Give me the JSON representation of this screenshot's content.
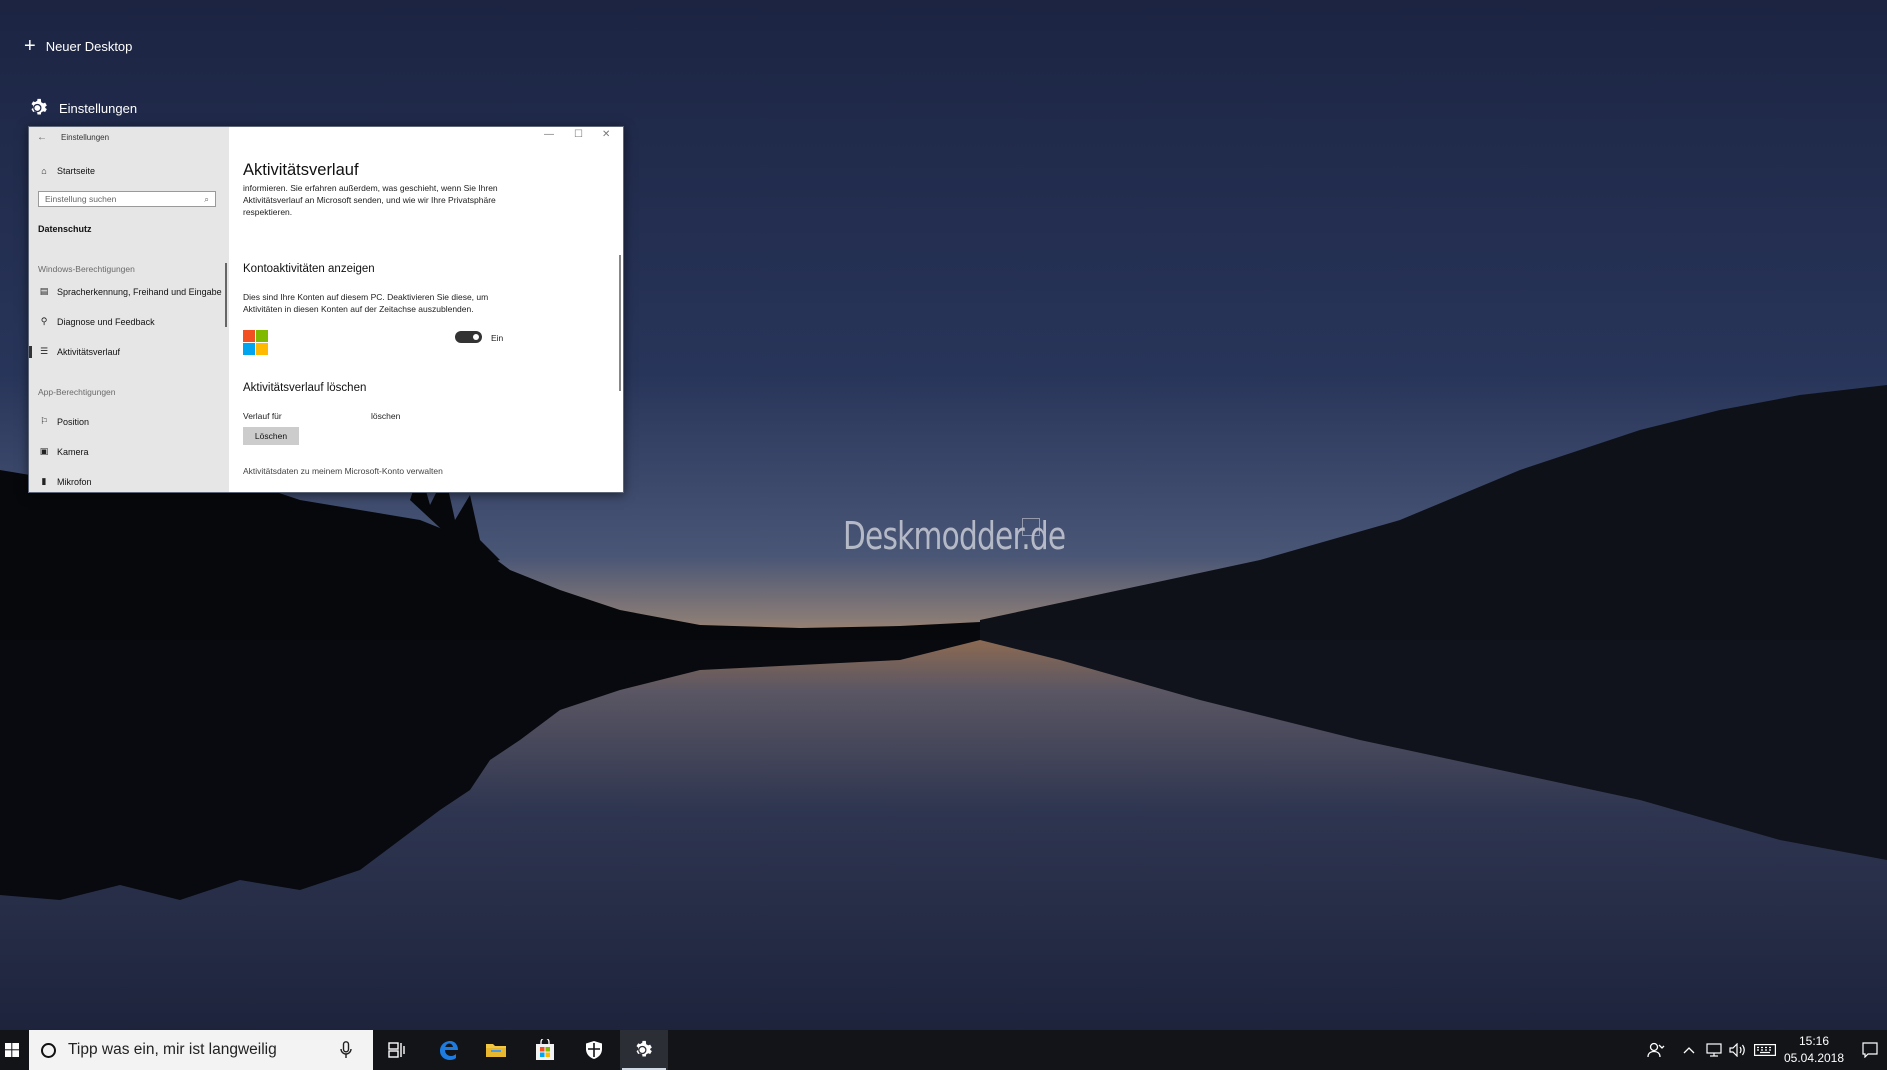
{
  "desktop": {
    "watermark": "Deskmodder.de",
    "new_desktop_label": "Neuer Desktop",
    "window_label": "Einstellungen"
  },
  "window": {
    "title": "Einstellungen",
    "sidebar": {
      "home": "Startseite",
      "search_placeholder": "Einstellung suchen",
      "section": "Datenschutz",
      "group_windows": "Windows-Berechtigungen",
      "items_windows": [
        "Spracherkennung, Freihand und Eingabe",
        "Diagnose und Feedback",
        "Aktivitätsverlauf"
      ],
      "group_apps": "App-Berechtigungen",
      "items_apps": [
        "Position",
        "Kamera",
        "Mikrofon"
      ]
    },
    "content": {
      "title": "Aktivitätsverlauf",
      "intro_lines": [
        "informieren. Sie erfahren außerdem, was geschieht, wenn Sie Ihren",
        "Aktivitätsverlauf an Microsoft senden, und wie wir Ihre Privatsphäre",
        "respektieren."
      ],
      "account_heading": "Kontoaktivitäten anzeigen",
      "account_lines": [
        "Dies sind Ihre Konten auf diesem PC. Deaktivieren Sie diese, um",
        "Aktivitäten in diesen Konten auf der Zeitachse auszublenden."
      ],
      "toggle_label": "Ein",
      "delete_heading": "Aktivitätsverlauf löschen",
      "history_for": "Verlauf für",
      "delete_word": "löschen",
      "delete_button": "Löschen",
      "manage_link": "Aktivitätsdaten zu meinem Microsoft-Konto verwalten"
    }
  },
  "taskbar": {
    "search_placeholder": "Tipp was ein, mir ist langweilig",
    "time": "15:16",
    "date": "05.04.2018"
  },
  "colors": {
    "ms_red": "#f25022",
    "ms_green": "#7fba00",
    "ms_blue": "#00a4ef",
    "ms_yellow": "#ffb900",
    "edge_blue": "#1e7be0",
    "explorer_yellow": "#f2c744"
  }
}
